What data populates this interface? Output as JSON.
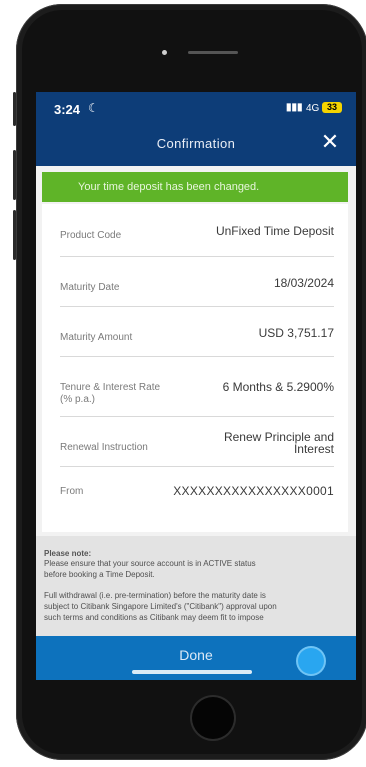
{
  "status_bar": {
    "time": "3:24",
    "signal": "․․▌",
    "network": "4G",
    "battery": "33"
  },
  "header": {
    "title": "Confirmation",
    "close_icon": "close-icon"
  },
  "banner": {
    "text": "Your time deposit has been changed."
  },
  "details": [
    {
      "label": "Product Code",
      "value": "UnFixed Time Deposit"
    },
    {
      "label": "Maturity Date",
      "value": "18/03/2024"
    },
    {
      "label": "Maturity Amount",
      "value": "USD 3,751.17"
    },
    {
      "label": "Tenure & Interest Rate",
      "label2": "(% p.a.)",
      "value": "6 Months & 5.2900%"
    },
    {
      "label": "Renewal Instruction",
      "value": "Renew Principle and",
      "value2": "Interest"
    },
    {
      "label": "From",
      "value": "XXXXXXXXXXXXXXXX0001"
    }
  ],
  "notes": {
    "heading": "Please note:",
    "line1": "Please ensure that your source account is in ACTIVE status",
    "line2": "before booking a Time Deposit.",
    "line3": "Full withdrawal (i.e. pre-termination) before the maturity date is",
    "line4": "subject to Citibank Singapore Limited's (\"Citibank\") approval upon",
    "line5": "such terms and conditions as Citibank may deem fit to impose"
  },
  "footer": {
    "done_label": "Done"
  },
  "colors": {
    "header": "#0d3d78",
    "banner": "#5fb428",
    "footer": "#0d72bd"
  }
}
